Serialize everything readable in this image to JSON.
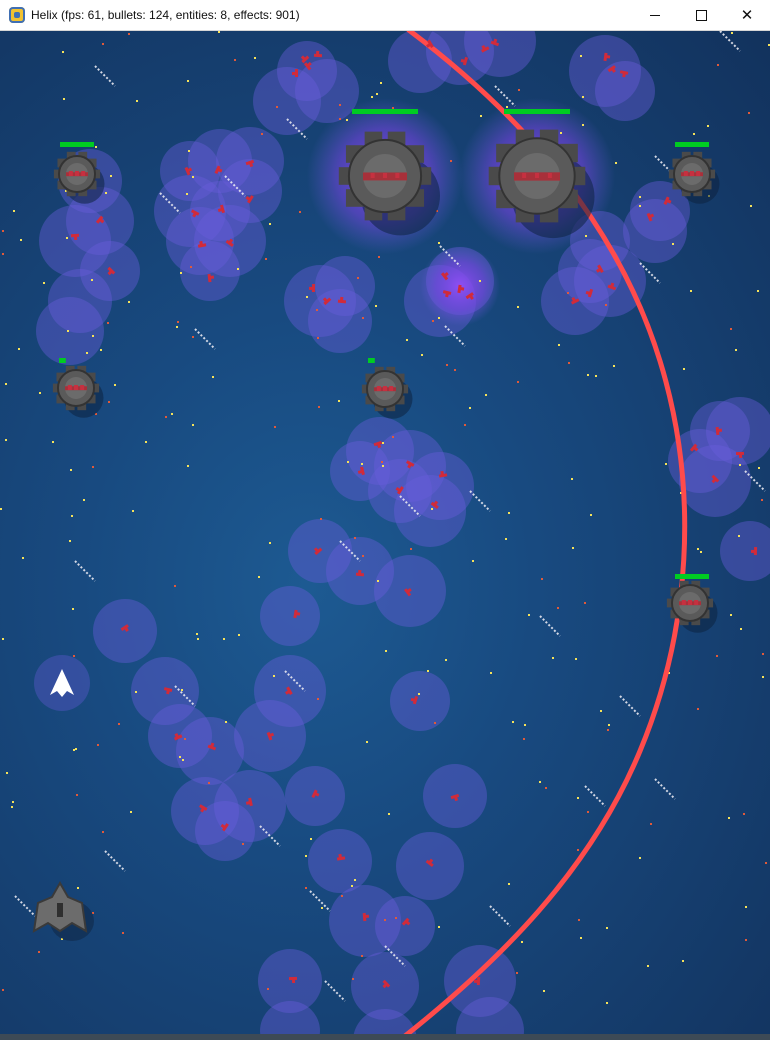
{
  "window": {
    "title": "Helix (fps: 61, bullets: 124, entities: 8, effects: 901)",
    "app_icon": "python-snake-icon",
    "controls": {
      "minimize": "minimize-icon",
      "maximize": "maximize-icon",
      "close": "close-icon"
    }
  },
  "game": {
    "background_color": "#184a80",
    "laser_color": "#ff4b4b",
    "bullet_color": "#d12b3a",
    "aura_color": "#6a5cdc",
    "health_bar_color": "#00cc22",
    "player": {
      "icon": "player-ship-icon",
      "color": "#ffffff"
    },
    "ally": {
      "icon": "grey-fighter-ship-icon"
    },
    "enemies": {
      "large_count": 2,
      "small_count": 5,
      "icon_large": "large-gear-enemy-icon",
      "icon_small": "small-gear-enemy-icon"
    },
    "enemy_health": {
      "boss_left": 1.0,
      "boss_right": 1.0,
      "small_top_left": 1.0,
      "small_top_right": 1.0,
      "small_right": 1.0,
      "small_center": 0.2,
      "small_left": 0.2
    }
  }
}
